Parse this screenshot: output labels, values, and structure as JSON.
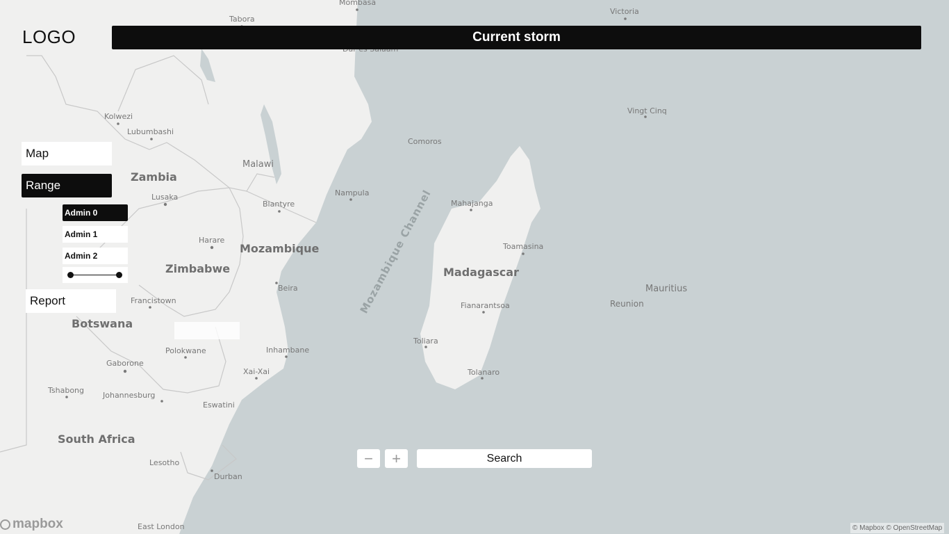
{
  "header": {
    "logo": "LOGO",
    "title": "Current storm"
  },
  "sidebar": {
    "map_label": "Map",
    "range_label": "Range",
    "admin_levels": [
      "Admin 0",
      "Admin 1",
      "Admin 2"
    ],
    "selected_admin": "Admin 0",
    "report_label": "Report"
  },
  "controls": {
    "zoom_out": "−",
    "zoom_in": "+",
    "search_label": "Search"
  },
  "map": {
    "countries": [
      "Zambia",
      "Mozambique",
      "Zimbabwe",
      "Botswana",
      "South Africa",
      "Madagascar",
      "Malawi"
    ],
    "cities": [
      "Tabora",
      "Mombasa",
      "Victoria",
      "Dar es Salaam",
      "Kolwezi",
      "Lubumbashi",
      "Lusaka",
      "Harare",
      "Blantyre",
      "Nampula",
      "Comoros",
      "Mahajanga",
      "Toamasina",
      "Fianarantsoa",
      "Toliara",
      "Tolanaro",
      "Beira",
      "Francistown",
      "Polokwane",
      "Inhambane",
      "Xai-Xai",
      "Gaborone",
      "Tshabong",
      "Johannesburg",
      "Eswatini",
      "Lesotho",
      "Durban",
      "East London",
      "Vingt Cinq",
      "Mauritius",
      "Reunion"
    ],
    "sea": "Mozambique Channel"
  },
  "footer": {
    "mapbox": "mapbox",
    "attribution": "© Mapbox © OpenStreetMap"
  },
  "colors": {
    "water": "#c9d1d3",
    "land": "#f0f0ef",
    "dark": "#0d0d0d",
    "label": "#6f6f6f"
  }
}
